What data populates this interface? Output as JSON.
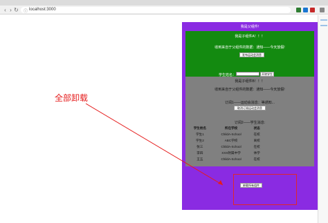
{
  "browser": {
    "url": "localhost:3000"
  },
  "parent": {
    "title": "我是父组件!"
  },
  "childA": {
    "title": "我是子组件A！！！",
    "received": "收到来自于父组件的数据：通知——今天放假!",
    "send_button": "发布运动会消息",
    "name_label": "学生姓名：",
    "name_value": "",
    "add_button": "开除学生"
  },
  "childB": {
    "title": "我是子组件B！！！",
    "received": "收到来自于父组件的数据：通知——今天放假!",
    "subscription1": "订阅1——运动会消息：等通知...",
    "cancel_button": "取消订阅运动会消息",
    "subscription2": "订阅2——学生消息:",
    "table": {
      "headers": [
        "学生姓名",
        "所在学校",
        "状态"
      ],
      "rows": [
        [
          "学生1",
          "ChildA-School",
          "在校"
        ],
        [
          "学生2",
          "ABC学校",
          "离校"
        ],
        [
          "张三",
          "ChildA-School",
          "在校"
        ],
        [
          "李四",
          "XXX附属中学",
          "休学"
        ],
        [
          "王五",
          "ChildA-School",
          "在校"
        ]
      ]
    }
  },
  "unmount_button": "卸载所有组件",
  "annotation": {
    "label": "全部卸载",
    "color": "#e51c1c"
  },
  "colors": {
    "parent_bg": "#8a2be2",
    "childA_bg": "#138a10",
    "childB_bg": "#808080"
  }
}
